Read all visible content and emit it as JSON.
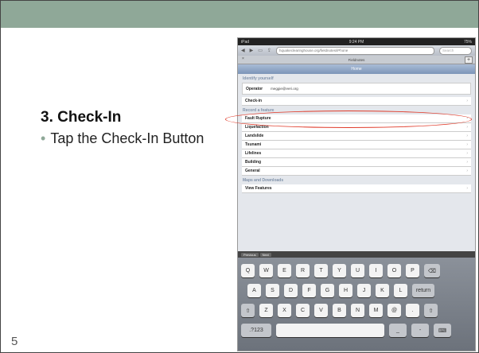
{
  "slide": {
    "heading": "3. Check-In",
    "bullet": "Tap the Check-In Button",
    "slide_number": "5"
  },
  "ipad": {
    "status_left": "iPad",
    "status_time": "9:24 PM",
    "status_right": "75%",
    "url": "hquakeclearinghouse.org/fieldnotes/iPhone",
    "search_placeholder": "Search",
    "tab_title": "Fieldnotes",
    "nav_title": "Home",
    "section_identify": "Identify yourself",
    "operator_label": "Operator",
    "operator_value": "meggie@eeri.org",
    "checkin_label": "Check-in",
    "section_record": "Record a feature",
    "features": [
      "Fault Rupture",
      "Liquefaction",
      "Landslide",
      "Tsunami",
      "Lifelines",
      "Building",
      "General"
    ],
    "section_maps": "Maps and Downloads",
    "view_features": "View Features",
    "kb_prev": "Previous",
    "kb_next": "Next",
    "keys_row1": [
      "Q",
      "W",
      "E",
      "R",
      "T",
      "Y",
      "U",
      "I",
      "O",
      "P",
      "⌫"
    ],
    "keys_row2": [
      "A",
      "S",
      "D",
      "F",
      "G",
      "H",
      "J",
      "K",
      "L",
      "return"
    ],
    "keys_row3": [
      "⇧",
      "Z",
      "X",
      "C",
      "V",
      "B",
      "N",
      "M",
      "@",
      ".",
      "⇧"
    ],
    "keys_row4": [
      ".?123",
      "",
      "_",
      "-",
      "⌨"
    ]
  }
}
